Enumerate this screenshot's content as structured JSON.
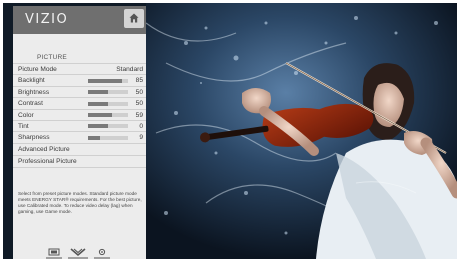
{
  "header": {
    "logo": "VIZIO"
  },
  "section": {
    "title": "PICTURE"
  },
  "menu": {
    "picture_mode": {
      "label": "Picture Mode",
      "value": "Standard"
    },
    "backlight": {
      "label": "Backlight",
      "value": "85",
      "level": 0.85
    },
    "brightness": {
      "label": "Brightness",
      "value": "50",
      "level": 0.5
    },
    "contrast": {
      "label": "Contrast",
      "value": "50",
      "level": 0.5
    },
    "color": {
      "label": "Color",
      "value": "59",
      "level": 0.59
    },
    "tint": {
      "label": "Tint",
      "value": "0",
      "level": 0.5
    },
    "sharpness": {
      "label": "Sharpness",
      "value": "9",
      "level": 0.3
    },
    "advanced": {
      "label": "Advanced Picture"
    },
    "professional": {
      "label": "Professional Picture"
    }
  },
  "help_text": "Select from preset picture modes. Standard picture mode meets ENERGY STAR® requirements. For the best picture, use Calibrated mode. To reduce video delay (lag) when gaming, use Game mode.",
  "icons": [
    "home-icon",
    "wide-icon",
    "down-chevron-icon",
    "settings-icon"
  ]
}
